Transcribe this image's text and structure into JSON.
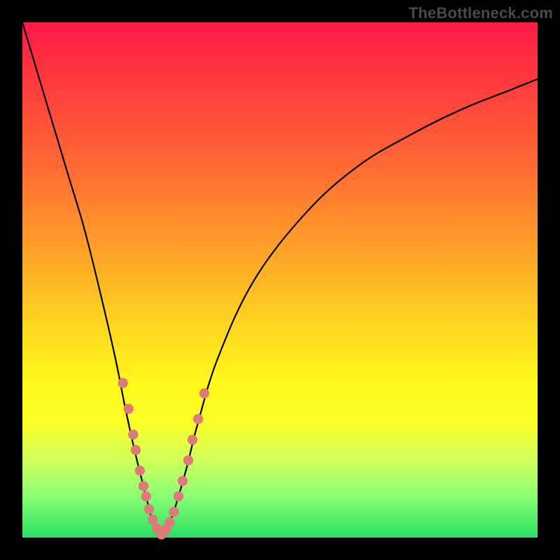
{
  "watermark": "TheBottleneck.com",
  "chart_data": {
    "type": "line",
    "title": "",
    "xlabel": "",
    "ylabel": "",
    "xrange": [
      0,
      100
    ],
    "yrange": [
      0,
      100
    ],
    "grid": false,
    "legend": false,
    "curve_description": "V-shaped curve descending from top-left to a minimum near x≈27 then rising asymptotically toward the upper right",
    "minimum_x": 27,
    "series": [
      {
        "name": "curve",
        "x": [
          0,
          3,
          6,
          9,
          12,
          15,
          18,
          20,
          22,
          24,
          25,
          26,
          27,
          28,
          29,
          30,
          32,
          34,
          38,
          45,
          55,
          65,
          75,
          85,
          95,
          100
        ],
        "y": [
          100,
          90,
          80,
          70,
          60,
          48,
          35,
          25,
          16,
          8,
          4,
          1.5,
          0.5,
          1.5,
          4,
          7,
          14,
          22,
          35,
          50,
          63,
          72,
          78,
          83,
          87,
          89
        ]
      }
    ],
    "markers": {
      "name": "highlighted-points",
      "color": "#e07a7a",
      "x": [
        19.5,
        20.6,
        21.5,
        22.0,
        22.8,
        23.5,
        24.0,
        24.6,
        25.3,
        26.1,
        27.0,
        27.9,
        28.6,
        29.4,
        30.3,
        31.1,
        32.2,
        33.0,
        34.1,
        35.3
      ],
      "y": [
        30,
        25,
        20,
        17,
        13,
        10,
        8,
        5.5,
        3.5,
        1.8,
        0.6,
        1.6,
        3.0,
        5.0,
        8.0,
        11,
        15,
        19,
        23,
        28
      ]
    }
  }
}
